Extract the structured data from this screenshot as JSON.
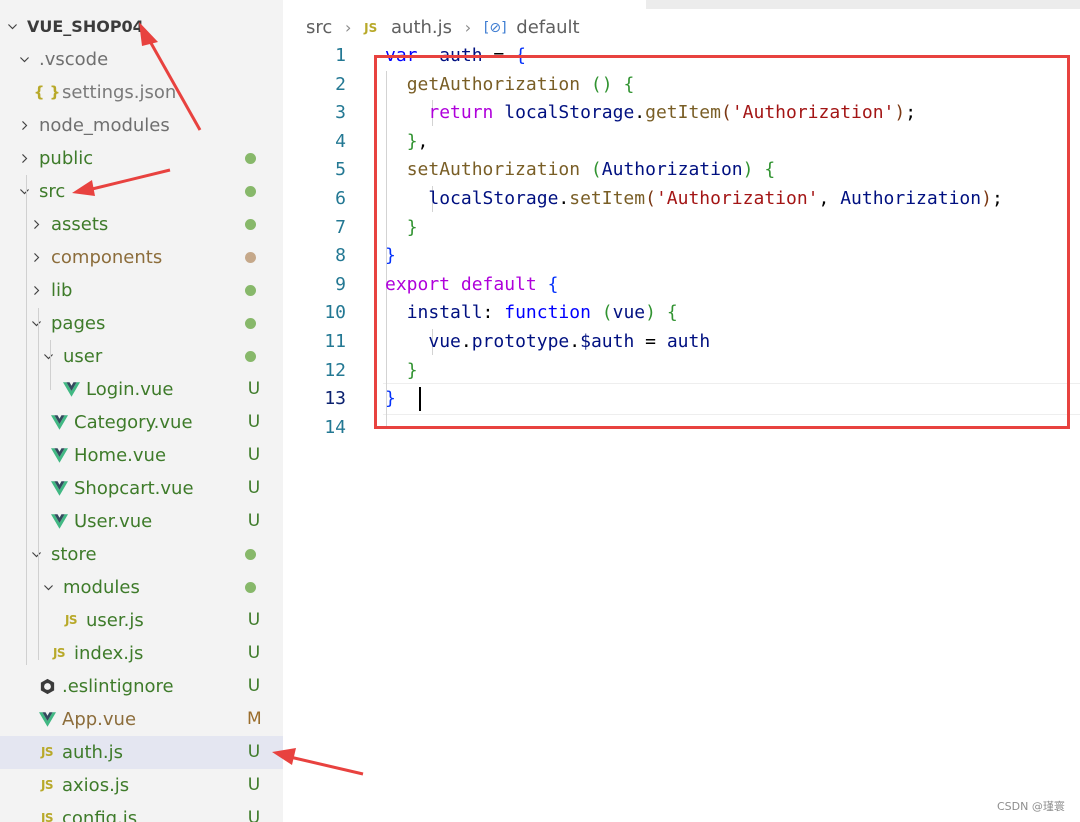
{
  "explorer": {
    "items": [
      {
        "label": "VUE_SHOP04",
        "type": "root",
        "state": "open"
      },
      {
        "label": ".vscode",
        "type": "folder",
        "state": "open",
        "tone": "dim"
      },
      {
        "label": "settings.json",
        "type": "json",
        "tone": "muted"
      },
      {
        "label": "node_modules",
        "type": "folder",
        "state": "closed",
        "tone": "dim"
      },
      {
        "label": "public",
        "type": "folder",
        "state": "closed",
        "tone": "green",
        "badge": "dot"
      },
      {
        "label": "src",
        "type": "folder",
        "state": "open",
        "tone": "green",
        "badge": "dot"
      },
      {
        "label": "assets",
        "type": "folder",
        "state": "closed",
        "tone": "green",
        "badge": "dot"
      },
      {
        "label": "components",
        "type": "folder",
        "state": "closed",
        "tone": "brown",
        "badge": "dot-brown"
      },
      {
        "label": "lib",
        "type": "folder",
        "state": "closed",
        "tone": "green",
        "badge": "dot"
      },
      {
        "label": "pages",
        "type": "folder",
        "state": "open",
        "tone": "green",
        "badge": "dot"
      },
      {
        "label": "user",
        "type": "folder",
        "state": "open",
        "tone": "green",
        "badge": "dot"
      },
      {
        "label": "Login.vue",
        "type": "vue",
        "tone": "green",
        "status": "U"
      },
      {
        "label": "Category.vue",
        "type": "vue",
        "tone": "green",
        "status": "U"
      },
      {
        "label": "Home.vue",
        "type": "vue",
        "tone": "green",
        "status": "U"
      },
      {
        "label": "Shopcart.vue",
        "type": "vue",
        "tone": "green",
        "status": "U"
      },
      {
        "label": "User.vue",
        "type": "vue",
        "tone": "green",
        "status": "U"
      },
      {
        "label": "store",
        "type": "folder",
        "state": "open",
        "tone": "green",
        "badge": "dot"
      },
      {
        "label": "modules",
        "type": "folder",
        "state": "open",
        "tone": "green",
        "badge": "dot"
      },
      {
        "label": "user.js",
        "type": "js",
        "tone": "green",
        "status": "U"
      },
      {
        "label": "index.js",
        "type": "js",
        "tone": "green",
        "status": "U"
      },
      {
        "label": ".eslintignore",
        "type": "eslint",
        "tone": "green",
        "status": "U"
      },
      {
        "label": "App.vue",
        "type": "vue",
        "tone": "brown",
        "status": "M"
      },
      {
        "label": "auth.js",
        "type": "js",
        "tone": "green",
        "status": "U",
        "selected": true
      },
      {
        "label": "axios.js",
        "type": "js",
        "tone": "green",
        "status": "U"
      },
      {
        "label": "config.js",
        "type": "js",
        "tone": "green",
        "status": "U"
      }
    ]
  },
  "breadcrumb": {
    "folder": "src",
    "file_icon": "JS",
    "file": "auth.js",
    "symbol_icon": "[⊘]",
    "symbol": "default"
  },
  "editor": {
    "active_line": 13,
    "lines": [
      {
        "n": "1",
        "tokens": [
          [
            "kw",
            "var"
          ],
          [
            "",
            "  "
          ],
          [
            "var",
            "auth"
          ],
          [
            "",
            " = "
          ],
          [
            "br1",
            "{"
          ]
        ]
      },
      {
        "n": "2",
        "tokens": [
          [
            "",
            "  "
          ],
          [
            "fn",
            "getAuthorization"
          ],
          [
            "",
            " "
          ],
          [
            "br2",
            "()"
          ],
          [
            "",
            " "
          ],
          [
            "br2",
            "{"
          ]
        ]
      },
      {
        "n": "3",
        "tokens": [
          [
            "",
            "    "
          ],
          [
            "ctl",
            "return"
          ],
          [
            "",
            " "
          ],
          [
            "var",
            "localStorage"
          ],
          [
            "",
            "."
          ],
          [
            "fn",
            "getItem"
          ],
          [
            "br3",
            "("
          ],
          [
            "str",
            "'Authorization'"
          ],
          [
            "br3",
            ")"
          ],
          [
            "",
            ";"
          ]
        ]
      },
      {
        "n": "4",
        "tokens": [
          [
            "",
            "  "
          ],
          [
            "br2",
            "}"
          ],
          [
            "",
            ","
          ]
        ]
      },
      {
        "n": "5",
        "tokens": [
          [
            "",
            "  "
          ],
          [
            "fn",
            "setAuthorization"
          ],
          [
            "",
            " "
          ],
          [
            "br2",
            "("
          ],
          [
            "var",
            "Authorization"
          ],
          [
            "br2",
            ")"
          ],
          [
            "",
            " "
          ],
          [
            "br2",
            "{"
          ]
        ]
      },
      {
        "n": "6",
        "tokens": [
          [
            "",
            "    "
          ],
          [
            "var",
            "localStorage"
          ],
          [
            "",
            "."
          ],
          [
            "fn",
            "setItem"
          ],
          [
            "br3",
            "("
          ],
          [
            "str",
            "'Authorization'"
          ],
          [
            "",
            ", "
          ],
          [
            "var",
            "Authorization"
          ],
          [
            "br3",
            ")"
          ],
          [
            "",
            ";"
          ]
        ]
      },
      {
        "n": "7",
        "tokens": [
          [
            "",
            "  "
          ],
          [
            "br2",
            "}"
          ]
        ]
      },
      {
        "n": "8",
        "tokens": [
          [
            "br1",
            "}"
          ]
        ]
      },
      {
        "n": "9",
        "tokens": [
          [
            "ctl",
            "export"
          ],
          [
            "",
            " "
          ],
          [
            "ctl",
            "default"
          ],
          [
            "",
            " "
          ],
          [
            "br1",
            "{"
          ]
        ]
      },
      {
        "n": "10",
        "tokens": [
          [
            "",
            "  "
          ],
          [
            "var",
            "install"
          ],
          [
            "",
            ": "
          ],
          [
            "kw",
            "function"
          ],
          [
            "",
            " "
          ],
          [
            "br2",
            "("
          ],
          [
            "var",
            "vue"
          ],
          [
            "br2",
            ")"
          ],
          [
            "",
            " "
          ],
          [
            "br2",
            "{"
          ]
        ]
      },
      {
        "n": "11",
        "tokens": [
          [
            "",
            "    "
          ],
          [
            "var",
            "vue"
          ],
          [
            "",
            "."
          ],
          [
            "var",
            "prototype"
          ],
          [
            "",
            "."
          ],
          [
            "var",
            "$auth"
          ],
          [
            "",
            " = "
          ],
          [
            "var",
            "auth"
          ]
        ]
      },
      {
        "n": "12",
        "tokens": [
          [
            "",
            "  "
          ],
          [
            "br2",
            "}"
          ]
        ]
      },
      {
        "n": "13",
        "tokens": [
          [
            "br1",
            "}"
          ]
        ]
      },
      {
        "n": "14",
        "tokens": []
      }
    ]
  },
  "watermark": "CSDN @瑾寰",
  "colors": {
    "annotation_red": "#e8423f",
    "git_dot": "#87b86a",
    "git_dot_brown": "#c5a88a"
  }
}
